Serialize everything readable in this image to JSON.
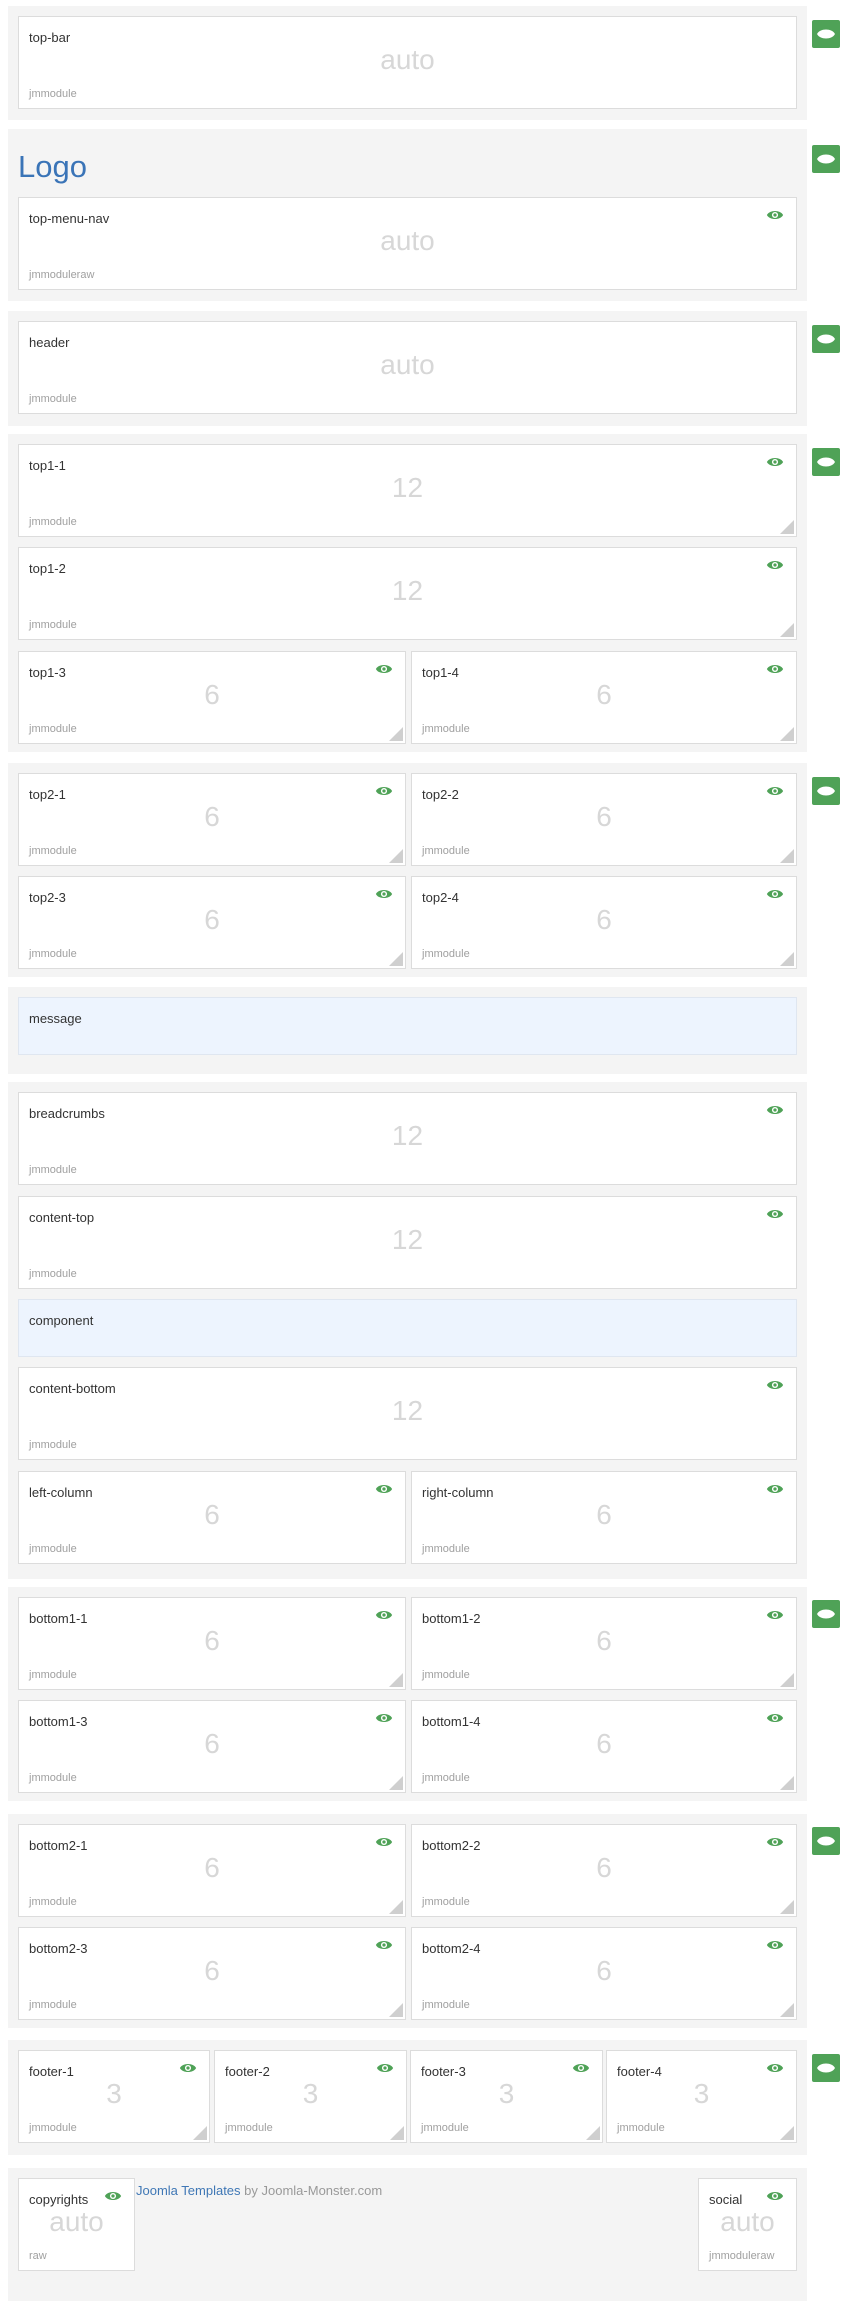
{
  "colors": {
    "accent": "#4fa257",
    "logo": "#3a74b7",
    "link": "#3f77b5",
    "system_bg": "#edf4fe"
  },
  "icons": {
    "visibility": "eye-icon",
    "resize": "resize-handle"
  },
  "logo_text": "Logo",
  "footer_credit": {
    "link": "Joomla Templates",
    "suffix": " by Joomla-Monster.com"
  },
  "sections": [
    {
      "id": "topbar",
      "modules": [
        {
          "name": "top-bar",
          "value": "auto",
          "style": "jmmodule"
        }
      ]
    },
    {
      "id": "logo",
      "modules": [
        {
          "name": "top-menu-nav",
          "value": "auto",
          "style": "jmmoduleraw"
        }
      ]
    },
    {
      "id": "header",
      "modules": [
        {
          "name": "header",
          "value": "auto",
          "style": "jmmodule"
        }
      ]
    },
    {
      "id": "top1",
      "modules": [
        {
          "name": "top1-1",
          "value": "12",
          "style": "jmmodule"
        },
        {
          "name": "top1-2",
          "value": "12",
          "style": "jmmodule"
        },
        {
          "name": "top1-3",
          "value": "6",
          "style": "jmmodule"
        },
        {
          "name": "top1-4",
          "value": "6",
          "style": "jmmodule"
        }
      ]
    },
    {
      "id": "top2",
      "modules": [
        {
          "name": "top2-1",
          "value": "6",
          "style": "jmmodule"
        },
        {
          "name": "top2-2",
          "value": "6",
          "style": "jmmodule"
        },
        {
          "name": "top2-3",
          "value": "6",
          "style": "jmmodule"
        },
        {
          "name": "top2-4",
          "value": "6",
          "style": "jmmodule"
        }
      ]
    },
    {
      "id": "message",
      "modules": [
        {
          "name": "message"
        }
      ]
    },
    {
      "id": "main",
      "modules": [
        {
          "name": "breadcrumbs",
          "value": "12",
          "style": "jmmodule"
        },
        {
          "name": "content-top",
          "value": "12",
          "style": "jmmodule"
        },
        {
          "name": "component"
        },
        {
          "name": "content-bottom",
          "value": "12",
          "style": "jmmodule"
        },
        {
          "name": "left-column",
          "value": "6",
          "style": "jmmodule"
        },
        {
          "name": "right-column",
          "value": "6",
          "style": "jmmodule"
        }
      ]
    },
    {
      "id": "bottom1",
      "modules": [
        {
          "name": "bottom1-1",
          "value": "6",
          "style": "jmmodule"
        },
        {
          "name": "bottom1-2",
          "value": "6",
          "style": "jmmodule"
        },
        {
          "name": "bottom1-3",
          "value": "6",
          "style": "jmmodule"
        },
        {
          "name": "bottom1-4",
          "value": "6",
          "style": "jmmodule"
        }
      ]
    },
    {
      "id": "bottom2",
      "modules": [
        {
          "name": "bottom2-1",
          "value": "6",
          "style": "jmmodule"
        },
        {
          "name": "bottom2-2",
          "value": "6",
          "style": "jmmodule"
        },
        {
          "name": "bottom2-3",
          "value": "6",
          "style": "jmmodule"
        },
        {
          "name": "bottom2-4",
          "value": "6",
          "style": "jmmodule"
        }
      ]
    },
    {
      "id": "footer",
      "modules": [
        {
          "name": "footer-1",
          "value": "3",
          "style": "jmmodule"
        },
        {
          "name": "footer-2",
          "value": "3",
          "style": "jmmodule"
        },
        {
          "name": "footer-3",
          "value": "3",
          "style": "jmmodule"
        },
        {
          "name": "footer-4",
          "value": "3",
          "style": "jmmodule"
        }
      ]
    },
    {
      "id": "copyrights",
      "modules": [
        {
          "name": "copyrights",
          "value": "auto",
          "style": "raw"
        },
        {
          "name": "social",
          "value": "auto",
          "style": "jmmoduleraw"
        }
      ]
    }
  ]
}
